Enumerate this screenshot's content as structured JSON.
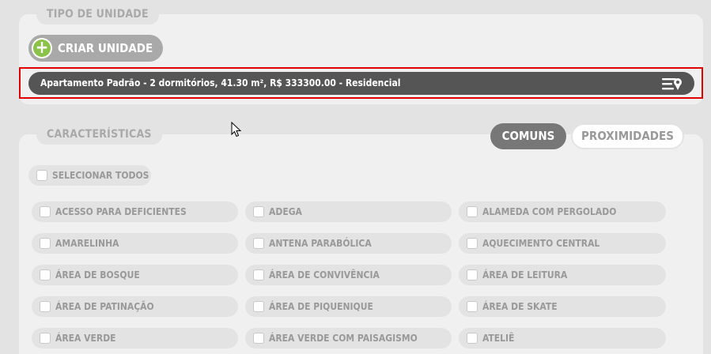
{
  "unit_type": {
    "legend": "TIPO DE UNIDADE",
    "create_button": "CRIAR UNIDADE",
    "unit_row": "Apartamento Padrão - 2 dormitórios, 41.30 m², R$ 333300.00 - Residencial"
  },
  "features": {
    "legend": "CARACTERÍSTICAS",
    "tabs": [
      "COMUNS",
      "PROXIMIDADES"
    ],
    "select_all": "SELECIONAR TODOS",
    "items": [
      "ACESSO PARA DEFICIENTES",
      "ADEGA",
      "ALAMEDA COM PERGOLADO",
      "AMARELINHA",
      "ANTENA PARABÓLICA",
      "AQUECIMENTO CENTRAL",
      "ÁREA DE BOSQUE",
      "ÁREA DE CONVIVÊNCIA",
      "ÁREA DE LEITURA",
      "ÁREA DE PATINAÇÃO",
      "ÁREA DE PIQUENIQUE",
      "ÁREA DE SKATE",
      "ÁREA VERDE",
      "ÁREA VERDE COM PAISAGISMO",
      "ATELIÊ"
    ]
  },
  "colors": {
    "accent_green": "#8bc34a",
    "highlight_red": "#e00000",
    "row_dark": "#555555"
  }
}
